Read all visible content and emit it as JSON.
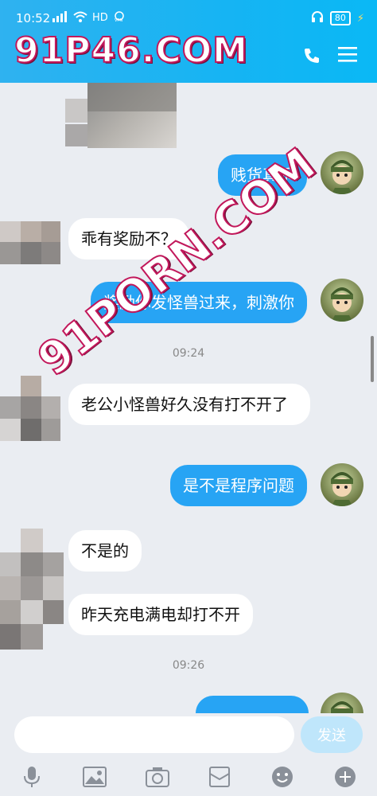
{
  "status": {
    "time": "10:52",
    "network": "HD",
    "battery": "80"
  },
  "header": {
    "watermark": "91P46.COM"
  },
  "watermark_diag": "91PORN.COM",
  "messages": [
    {
      "side": "out",
      "text": "贱货真乖"
    },
    {
      "side": "in",
      "text": "乖有奖励不？"
    },
    {
      "side": "out",
      "text": "奖励你发怪兽过来，刺激你"
    },
    {
      "side": "time",
      "text": "09:24"
    },
    {
      "side": "in",
      "text": "老公小怪兽好久没有打不开了"
    },
    {
      "side": "out",
      "text": "是不是程序问题"
    },
    {
      "side": "in",
      "text": "不是的"
    },
    {
      "side": "in",
      "text": "昨天充电满电却打不开"
    },
    {
      "side": "time",
      "text": "09:26"
    }
  ],
  "input": {
    "placeholder": "",
    "send_label": "发送"
  },
  "toolbar": [
    "mic-icon",
    "image-icon",
    "camera-icon",
    "mailbox-icon",
    "emoji-icon",
    "plus-icon"
  ],
  "colors": {
    "header": "#16b4f3",
    "bubble_out": "#27a4f4",
    "bubble_in": "#ffffff",
    "background": "#eaedf2",
    "send_disabled": "#bfe6fb"
  }
}
